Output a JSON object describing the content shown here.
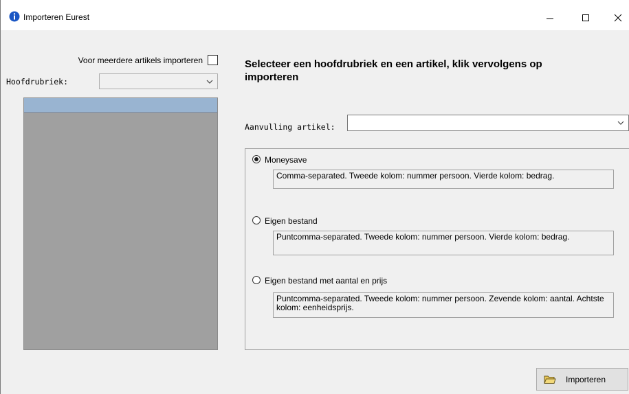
{
  "window": {
    "title": "Importeren Eurest"
  },
  "left": {
    "multi_label": "Voor meerdere artikels importeren",
    "hoofdrubriek_label": "Hoofdrubriek:",
    "hoofdrubriek_value": ""
  },
  "main": {
    "heading": "Selecteer een hoofdrubriek en een artikel, klik vervolgens op importeren",
    "aanvulling_label": "Aanvulling artikel:",
    "aanvulling_value": ""
  },
  "options": [
    {
      "label": "Moneysave",
      "selected": true,
      "description": "Comma-separated. Tweede kolom: nummer persoon. Vierde kolom: bedrag."
    },
    {
      "label": "Eigen bestand",
      "selected": false,
      "description": "Puntcomma-separated. Tweede kolom: nummer persoon. Vierde kolom: bedrag."
    },
    {
      "label": "Eigen bestand met aantal en prijs",
      "selected": false,
      "description": "Puntcomma-separated. Tweede kolom: nummer persoon. Zevende kolom: aantal. Achtste kolom: eenheidsprijs."
    }
  ],
  "footer": {
    "import_label": "Importeren"
  },
  "colors": {
    "list_header": "#99b4d1",
    "list_body": "#a0a0a0",
    "info_icon": "#1a56c4"
  },
  "icons": {
    "title": "info-icon",
    "button": "folder-icon"
  }
}
